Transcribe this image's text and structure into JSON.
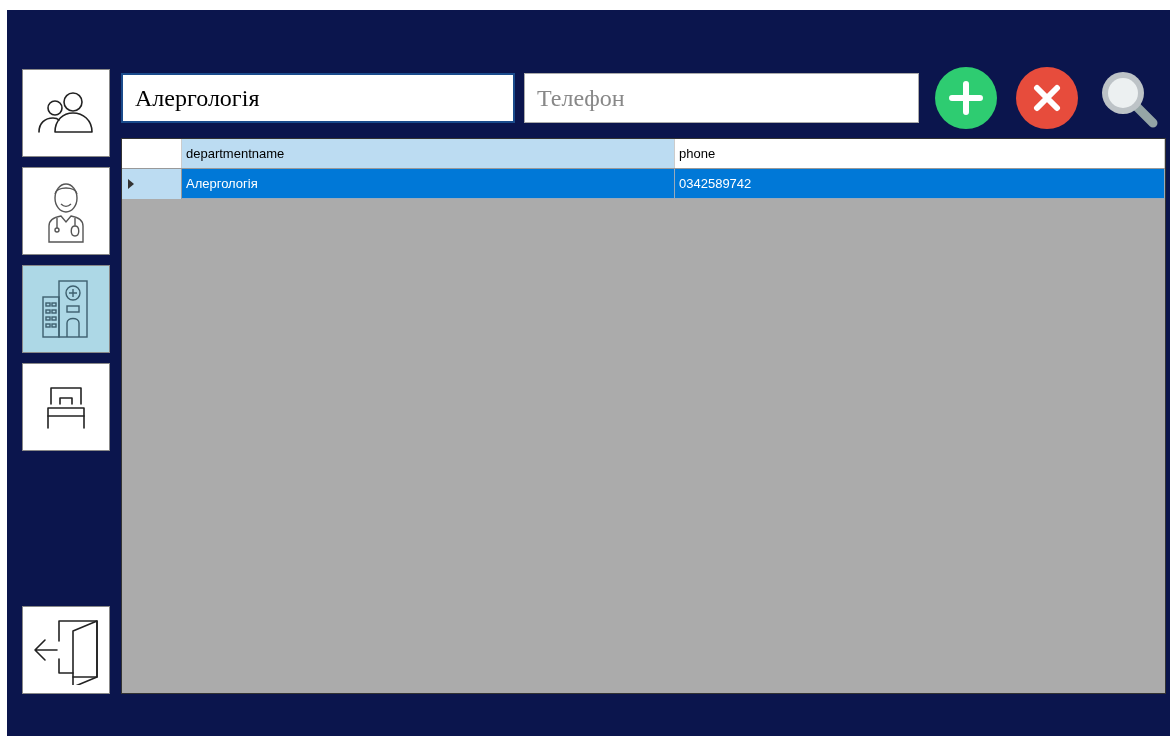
{
  "nav": [
    {
      "kind": "people",
      "selected": false
    },
    {
      "kind": "doctor",
      "selected": false
    },
    {
      "kind": "hospital",
      "selected": true
    },
    {
      "kind": "bed",
      "selected": false
    }
  ],
  "exit": {
    "kind": "exit"
  },
  "fields": {
    "name": {
      "value": "Алергологія"
    },
    "phone": {
      "placeholder": "Телефон"
    }
  },
  "actions": [
    {
      "kind": "add"
    },
    {
      "kind": "delete"
    },
    {
      "kind": "search"
    }
  ],
  "table": {
    "columns": [
      "departmentname",
      "phone"
    ],
    "rows": [
      {
        "cells": [
          "Алергологія",
          "0342589742"
        ],
        "selected": true
      }
    ]
  }
}
